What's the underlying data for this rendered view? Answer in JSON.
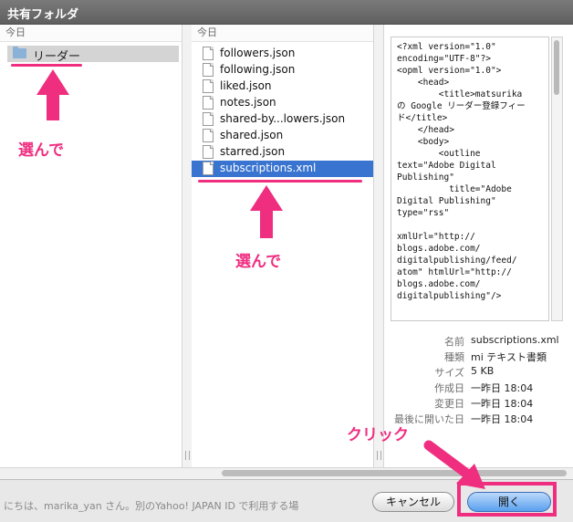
{
  "window": {
    "title": "共有フォルダ"
  },
  "column1": {
    "header": "今日",
    "items": [
      {
        "label": "リーダー",
        "icon": "folder-icon"
      }
    ]
  },
  "column2": {
    "header": "今日",
    "items": [
      {
        "label": "followers.json"
      },
      {
        "label": "following.json"
      },
      {
        "label": "liked.json"
      },
      {
        "label": "notes.json"
      },
      {
        "label": "shared-by...lowers.json"
      },
      {
        "label": "shared.json"
      },
      {
        "label": "starred.json"
      },
      {
        "label": "subscriptions.xml"
      }
    ],
    "selected": "subscriptions.xml"
  },
  "preview": {
    "text": "<?xml version=\"1.0\"\nencoding=\"UTF-8\"?>\n<opml version=\"1.0\">\n    <head>\n        <title>matsurika\nの Google リーダー登録フィー\nド</title>\n    </head>\n    <body>\n        <outline\ntext=\"Adobe Digital\nPublishing\"\n          title=\"Adobe\nDigital Publishing\"\ntype=\"rss\"\n\nxmlUrl=\"http://\nblogs.adobe.com/\ndigitalpublishing/feed/\natom\" htmlUrl=\"http://\nblogs.adobe.com/\ndigitalpublishing\"/>"
  },
  "info": [
    {
      "key": "名前",
      "value": "subscriptions.xml"
    },
    {
      "key": "種類",
      "value": "mi テキスト書類"
    },
    {
      "key": "サイズ",
      "value": "5 KB"
    },
    {
      "key": "作成日",
      "value": "一昨日 18:04"
    },
    {
      "key": "変更日",
      "value": "一昨日 18:04"
    },
    {
      "key": "最後に開いた日",
      "value": "一昨日 18:04"
    }
  ],
  "footer": {
    "background_text": "にちは、marika_yan さん。別のYahoo! JAPAN ID で利用する場",
    "cancel_label": "キャンセル",
    "open_label": "開く"
  },
  "annotations": {
    "choose1": "選んで",
    "choose2": "選んで",
    "click": "クリック",
    "color": "#ef2e80"
  },
  "colors": {
    "selection": "#3874d0",
    "accent": "#ef2e80"
  }
}
